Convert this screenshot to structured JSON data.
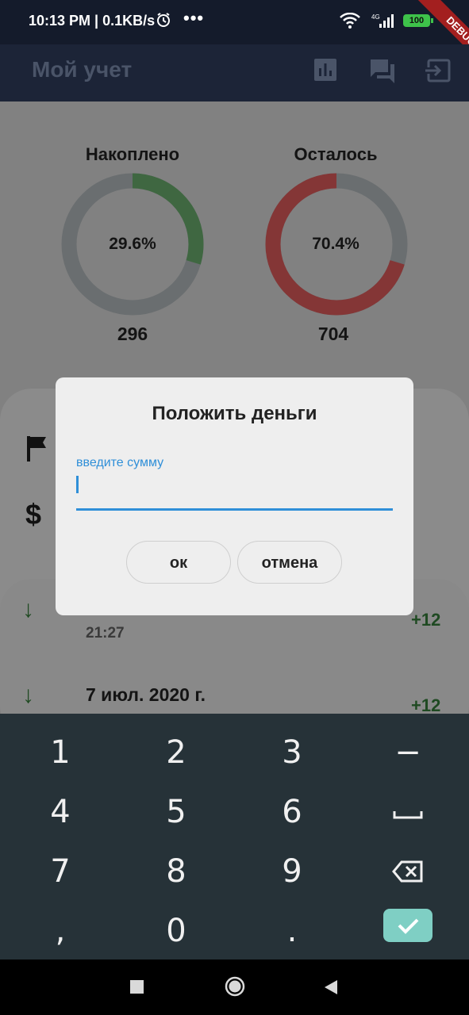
{
  "status_bar": {
    "time": "10:13 PM | 0.1KB/s",
    "more": "•••",
    "network": "4G",
    "battery": "100",
    "debug_banner": "DEBUG"
  },
  "app_bar": {
    "title": "Мой учет",
    "icons": [
      "bar-chart-icon",
      "chat-icon",
      "exit-icon"
    ]
  },
  "charts": [
    {
      "title": "Накоплено",
      "percent_label": "29.6%",
      "percent": 29.6,
      "value": "296",
      "color": "#2e7d32"
    },
    {
      "title": "Осталось",
      "percent_label": "70.4%",
      "percent": 70.4,
      "value": "704",
      "color": "#b71c1c"
    }
  ],
  "transactions": [
    {
      "time": "21:27",
      "amount": "+12"
    },
    {
      "date": "7 июл. 2020 г.",
      "amount": "+12"
    }
  ],
  "dialog": {
    "title": "Положить деньги",
    "input_label": "введите сумму",
    "input_value": "",
    "ok_label": "ок",
    "cancel_label": "отмена"
  },
  "keyboard": {
    "rows": [
      [
        "1",
        "2",
        "3",
        "−"
      ],
      [
        "4",
        "5",
        "6",
        "␣"
      ],
      [
        "7",
        "8",
        "9",
        "⌫"
      ],
      [
        ",",
        "0",
        ".",
        "✓"
      ]
    ]
  },
  "colors": {
    "accent": "#2f8fd8",
    "keyboard_bg": "#263238",
    "done_key": "#7fcfc4"
  }
}
